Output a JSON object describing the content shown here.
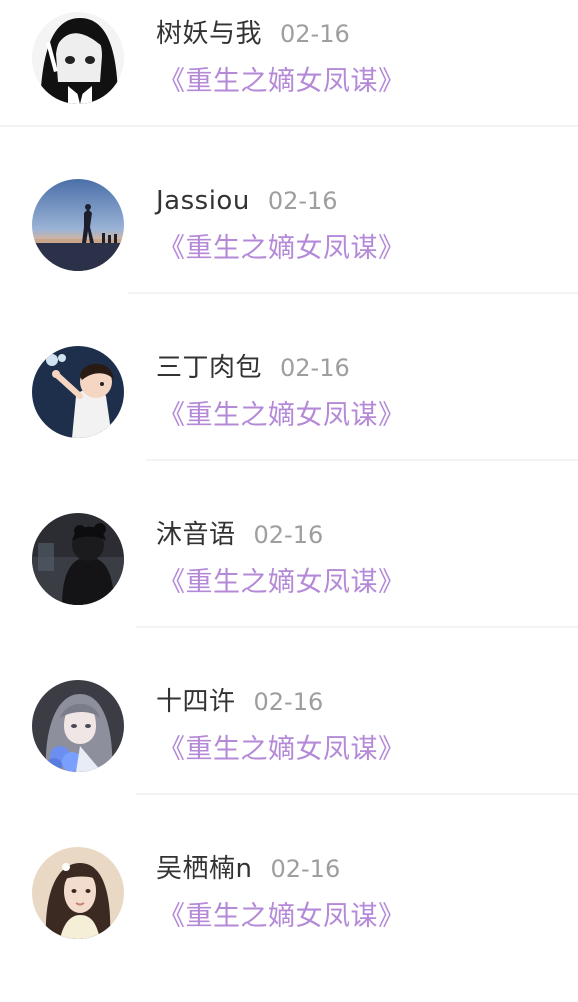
{
  "comments": [
    {
      "user": "树妖与我",
      "date": "02-16",
      "book": "《重生之嫡女凤谋》",
      "avatar": "manga-girl-avatar"
    },
    {
      "user": "Jassiou",
      "date": "02-16",
      "book": "《重生之嫡女凤谋》",
      "avatar": "beach-sunset-avatar"
    },
    {
      "user": "三丁肉包",
      "date": "02-16",
      "book": "《重生之嫡女凤谋》",
      "avatar": "cartoon-boy-avatar"
    },
    {
      "user": "沐音语",
      "date": "02-16",
      "book": "《重生之嫡女凤谋》",
      "avatar": "dark-portrait-avatar"
    },
    {
      "user": "十四许",
      "date": "02-16",
      "book": "《重生之嫡女凤谋》",
      "avatar": "anime-girl-avatar"
    },
    {
      "user": "吴栖楠n",
      "date": "02-16",
      "book": "《重生之嫡女凤谋》",
      "avatar": "photo-girl-avatar"
    }
  ],
  "colors": {
    "name": "#333333",
    "date": "#9e9e9e",
    "book_title": "#b48ad8",
    "divider": "#f3f3f3"
  }
}
